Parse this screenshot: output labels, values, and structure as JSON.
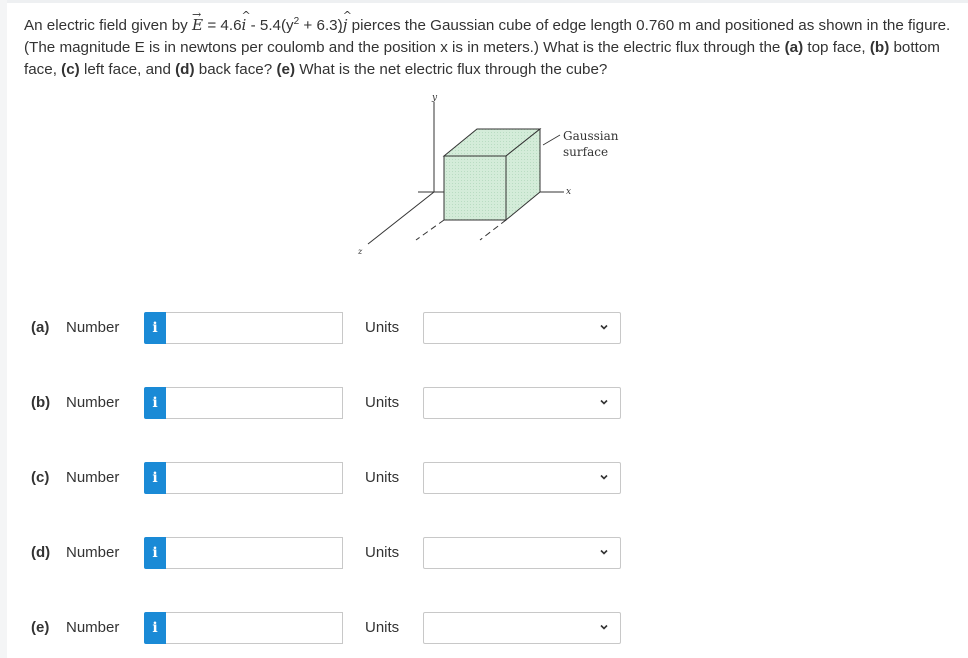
{
  "question": {
    "intro": "An electric field given by ",
    "vector_symbol": "E",
    "vector_arrow": "→",
    "equals_part": " = 4.6",
    "i_hat": "i",
    "hat_mark": "^",
    "minus_part": " - 5.4(y",
    "exponent": "2",
    "plus_part": " + 6.3)",
    "j_hat": "j",
    "after_field": " pierces the Gaussian cube of edge length 0.760 m and positioned as shown in the figure. (The magnitude E is in newtons per coulomb and the position x is in meters.) What is the electric flux through the ",
    "a_label": "(a)",
    "a_text": " top face, ",
    "b_label": "(b)",
    "b_text": " bottom face, ",
    "c_label": "(c)",
    "c_text": " left face, and ",
    "d_label": "(d)",
    "d_text": " back face? ",
    "e_label": "(e)",
    "e_text": " What is the net electric flux through the cube?"
  },
  "figure": {
    "y_axis_label": "y",
    "x_axis_label": "x",
    "z_axis_label": "z",
    "surface_label_line1": "Gaussian",
    "surface_label_line2": "surface",
    "cube_color": "#cfe9d6"
  },
  "answers": [
    {
      "letter": "(a)",
      "number_label": "Number",
      "info_icon": "i",
      "number_value": "",
      "units_label": "Units",
      "units_value": ""
    },
    {
      "letter": "(b)",
      "number_label": "Number",
      "info_icon": "i",
      "number_value": "",
      "units_label": "Units",
      "units_value": ""
    },
    {
      "letter": "(c)",
      "number_label": "Number",
      "info_icon": "i",
      "number_value": "",
      "units_label": "Units",
      "units_value": ""
    },
    {
      "letter": "(d)",
      "number_label": "Number",
      "info_icon": "i",
      "number_value": "",
      "units_label": "Units",
      "units_value": ""
    },
    {
      "letter": "(e)",
      "number_label": "Number",
      "info_icon": "i",
      "number_value": "",
      "units_label": "Units",
      "units_value": ""
    }
  ],
  "colors": {
    "info_button": "#1a8ad6",
    "text": "#333333",
    "border": "#c8c8c8"
  }
}
